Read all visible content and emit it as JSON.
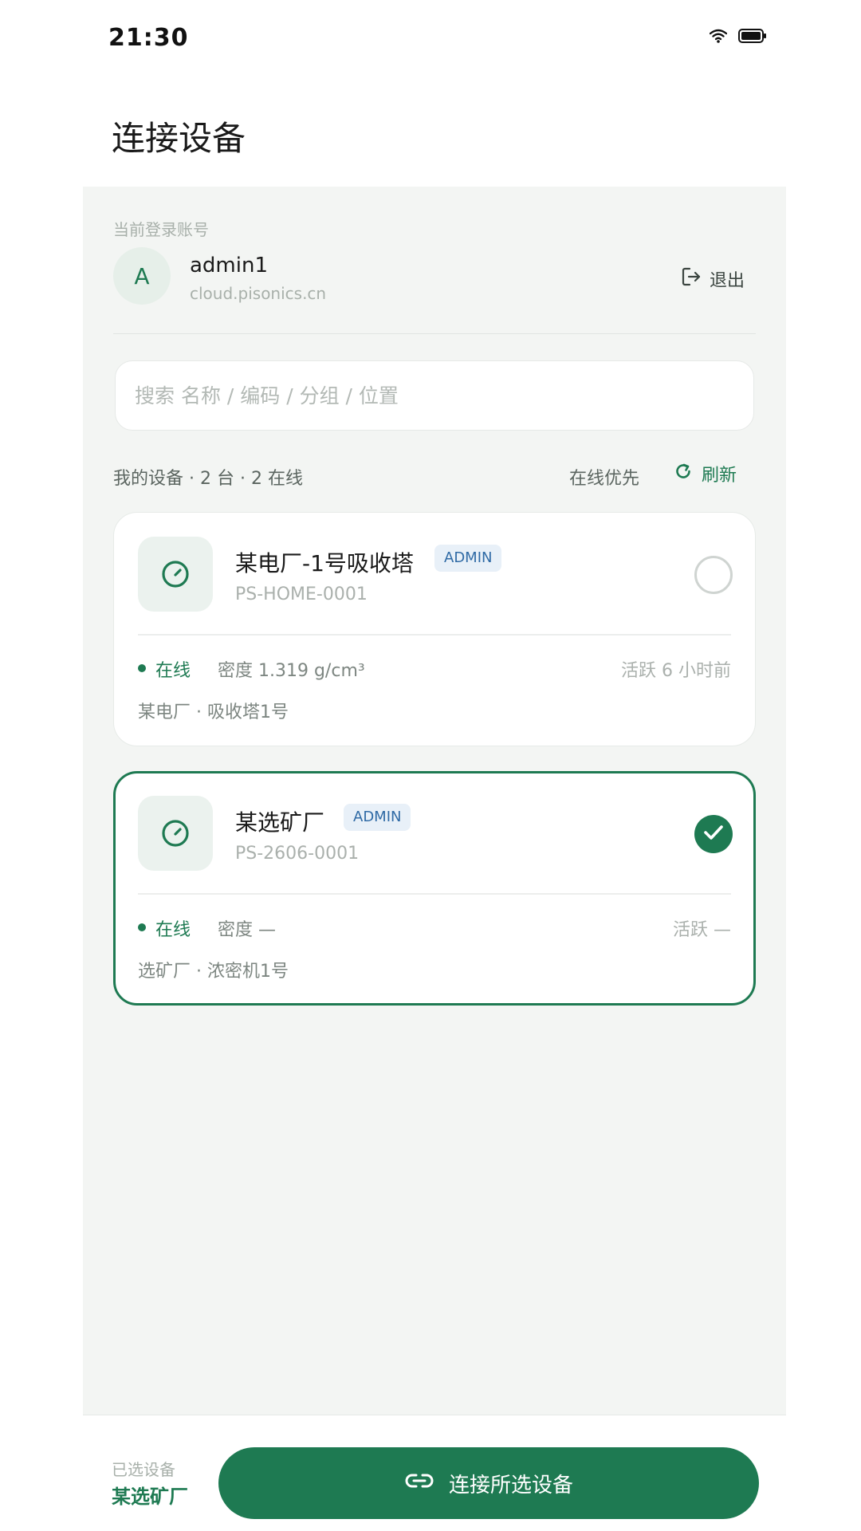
{
  "status_bar": {
    "time": "21:30"
  },
  "page": {
    "title": "连接设备"
  },
  "account": {
    "caption": "当前登录账号",
    "avatar_letter": "A",
    "name": "admin1",
    "host": "cloud.pisonics.cn",
    "logout_label": "退出"
  },
  "search": {
    "placeholder": "搜索 名称 / 编码 / 分组 / 位置"
  },
  "list_header": {
    "summary": "我的设备 · 2 台 · 2 在线",
    "sort_label": "在线优先",
    "refresh_label": "刷新"
  },
  "devices": [
    {
      "name": "某电厂-1号吸收塔",
      "role": "ADMIN",
      "code": "PS-HOME-0001",
      "status": "在线",
      "density": "密度 1.319 g/cm³",
      "active": "活跃 6 小时前",
      "location": "某电厂 · 吸收塔1号",
      "selected": false
    },
    {
      "name": "某选矿厂",
      "role": "ADMIN",
      "code": "PS-2606-0001",
      "status": "在线",
      "density": "密度 —",
      "active": "活跃 —",
      "location": "选矿厂 · 浓密机1号",
      "selected": true
    }
  ],
  "bottom_bar": {
    "selected_caption": "已选设备",
    "selected_value": "某选矿厂",
    "connect_label": "连接所选设备"
  },
  "colors": {
    "accent": "#1e7a52",
    "badge_bg": "#e8f0f8",
    "badge_text": "#2f6aa5",
    "panel_bg": "#f3f5f3"
  },
  "icons": {
    "wifi": "wifi-icon",
    "battery": "battery-icon",
    "logout": "logout-icon",
    "refresh": "refresh-icon",
    "device": "gauge-icon",
    "selected": "check-icon",
    "connect": "link-icon"
  }
}
